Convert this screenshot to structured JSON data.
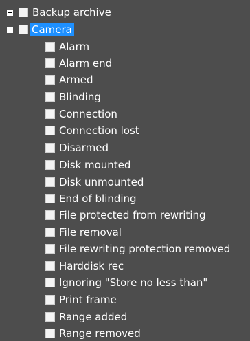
{
  "tree": {
    "groups": [
      {
        "label": "Backup archive",
        "expander": "plus-icon",
        "selected": false,
        "checked": false
      },
      {
        "label": "Camera",
        "expander": "minus-icon",
        "selected": true,
        "checked": false,
        "children": [
          {
            "label": "Alarm",
            "checked": false
          },
          {
            "label": "Alarm end",
            "checked": false
          },
          {
            "label": "Armed",
            "checked": false
          },
          {
            "label": "Blinding",
            "checked": false
          },
          {
            "label": "Connection",
            "checked": false
          },
          {
            "label": "Connection lost",
            "checked": false
          },
          {
            "label": "Disarmed",
            "checked": false
          },
          {
            "label": "Disk mounted",
            "checked": false
          },
          {
            "label": "Disk unmounted",
            "checked": false
          },
          {
            "label": "End of blinding",
            "checked": false
          },
          {
            "label": "File protected from rewriting",
            "checked": false
          },
          {
            "label": "File removal",
            "checked": false
          },
          {
            "label": "File rewriting protection removed",
            "checked": false
          },
          {
            "label": "Harddisk rec",
            "checked": false
          },
          {
            "label": "Ignoring \"Store no less than\"",
            "checked": false
          },
          {
            "label": "Print frame",
            "checked": false
          },
          {
            "label": "Range added",
            "checked": false
          },
          {
            "label": "Range removed",
            "checked": false
          }
        ]
      }
    ]
  }
}
